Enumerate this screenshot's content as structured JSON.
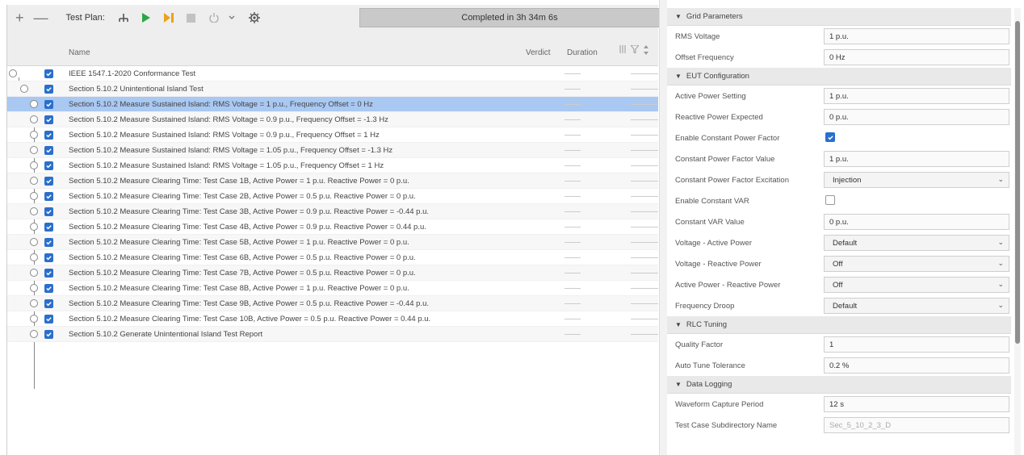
{
  "toolbar": {
    "add_label": "+",
    "remove_label": "—",
    "test_plan_label": "Test Plan:",
    "status": "Completed in 3h 34m 6s"
  },
  "columns": {
    "name": "Name",
    "verdict": "Verdict",
    "duration": "Duration"
  },
  "tree": {
    "root": "IEEE 1547.1-2020 Conformance Test",
    "section": "Section 5.10.2 Unintentional Island Test",
    "items": [
      {
        "label": "Section 5.10.2 Measure Sustained Island: RMS Voltage = 1 p.u., Frequency Offset = 0 Hz"
      },
      {
        "label": "Section 5.10.2 Measure Sustained Island: RMS Voltage = 0.9 p.u., Frequency Offset = -1.3 Hz"
      },
      {
        "label": "Section 5.10.2 Measure Sustained Island: RMS Voltage = 0.9 p.u., Frequency Offset = 1 Hz"
      },
      {
        "label": "Section 5.10.2 Measure Sustained Island: RMS Voltage = 1.05 p.u., Frequency Offset = -1.3 Hz"
      },
      {
        "label": "Section 5.10.2 Measure Sustained Island: RMS Voltage = 1.05 p.u., Frequency Offset = 1 Hz"
      },
      {
        "label": "Section 5.10.2 Measure Clearing Time: Test Case 1B, Active Power = 1 p.u. Reactive Power = 0 p.u."
      },
      {
        "label": "Section 5.10.2 Measure Clearing Time: Test Case 2B, Active Power = 0.5 p.u. Reactive Power = 0 p.u."
      },
      {
        "label": "Section 5.10.2 Measure Clearing Time: Test Case 3B, Active Power = 0.9 p.u. Reactive Power = -0.44 p.u."
      },
      {
        "label": "Section 5.10.2 Measure Clearing Time: Test Case 4B, Active Power = 0.9 p.u. Reactive Power = 0.44 p.u."
      },
      {
        "label": "Section 5.10.2 Measure Clearing Time: Test Case 5B, Active Power = 1 p.u. Reactive Power = 0 p.u."
      },
      {
        "label": "Section 5.10.2 Measure Clearing Time: Test Case 6B, Active Power = 0.5 p.u. Reactive Power = 0 p.u."
      },
      {
        "label": "Section 5.10.2 Measure Clearing Time: Test Case 7B, Active Power = 0.5 p.u. Reactive Power = 0 p.u."
      },
      {
        "label": "Section 5.10.2 Measure Clearing Time: Test Case 8B, Active Power = 1 p.u. Reactive Power = 0 p.u."
      },
      {
        "label": "Section 5.10.2 Measure Clearing Time: Test Case 9B, Active Power = 0.5 p.u. Reactive Power = -0.44 p.u."
      },
      {
        "label": "Section 5.10.2 Measure Clearing Time: Test Case 10B, Active Power = 0.5 p.u. Reactive Power = 0.44 p.u."
      },
      {
        "label": "Section 5.10.2 Generate Unintentional Island Test Report"
      }
    ]
  },
  "props": {
    "grid": {
      "title": "Grid Parameters",
      "rms_voltage_label": "RMS Voltage",
      "rms_voltage": "1 p.u.",
      "offset_freq_label": "Offset Frequency",
      "offset_freq": "0 Hz"
    },
    "eut": {
      "title": "EUT Configuration",
      "active_power_label": "Active Power Setting",
      "active_power": "1 p.u.",
      "reactive_expected_label": "Reactive Power Expected",
      "reactive_expected": "0 p.u.",
      "enable_cpf_label": "Enable Constant Power Factor",
      "cpf_value_label": "Constant Power Factor Value",
      "cpf_value": "1 p.u.",
      "cpf_excitation_label": "Constant Power Factor Excitation",
      "cpf_excitation": "Injection",
      "enable_cvar_label": "Enable Constant VAR",
      "cvar_value_label": "Constant VAR Value",
      "cvar_value": "0 p.u.",
      "volt_active_label": "Voltage - Active Power",
      "volt_active": "Default",
      "volt_reactive_label": "Voltage - Reactive Power",
      "volt_reactive": "Off",
      "active_reactive_label": "Active Power - Reactive Power",
      "active_reactive": "Off",
      "freq_droop_label": "Frequency Droop",
      "freq_droop": "Default"
    },
    "rlc": {
      "title": "RLC Tuning",
      "quality_label": "Quality Factor",
      "quality": "1",
      "tolerance_label": "Auto Tune Tolerance",
      "tolerance": "0.2 %"
    },
    "logging": {
      "title": "Data Logging",
      "capture_label": "Waveform Capture Period",
      "capture": "12 s",
      "subdir_label": "Test Case Subdirectory Name",
      "subdir": "Sec_5_10_2_3_D"
    }
  },
  "colors": {
    "accent": "#2b6fcc",
    "selected_row": "#a9c8f2",
    "run_green": "#2aa845",
    "pause_orange": "#e9a21b"
  }
}
